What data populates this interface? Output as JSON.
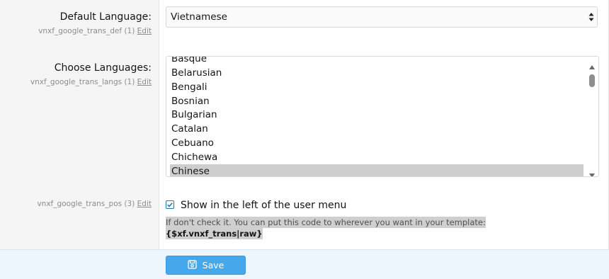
{
  "default_language": {
    "label": "Default Language:",
    "option_id": "vnxf_google_trans_def (1)",
    "edit_label": "Edit",
    "selected_value": "Vietnamese"
  },
  "choose_languages": {
    "label": "Choose Languages:",
    "option_id": "vnxf_google_trans_langs (1)",
    "edit_label": "Edit",
    "options": [
      "Basque",
      "Belarusian",
      "Bengali",
      "Bosnian",
      "Bulgarian",
      "Catalan",
      "Cebuano",
      "Chichewa",
      "Chinese"
    ],
    "selected": "Chinese"
  },
  "trans_pos": {
    "option_id": "vnxf_google_trans_pos (3)",
    "edit_label": "Edit",
    "checkbox_label": "Show in the left of the user menu",
    "checked": true,
    "explain_text": "If don't check it. You can put this code to wherever you want in your template:",
    "code_text": "{$xf.vnxf_trans|raw}"
  },
  "footer": {
    "save_label": "Save"
  },
  "colors": {
    "accent": "#47a7eb",
    "footer_bg": "#edf6fd",
    "label_bg": "#f5f5f5"
  }
}
